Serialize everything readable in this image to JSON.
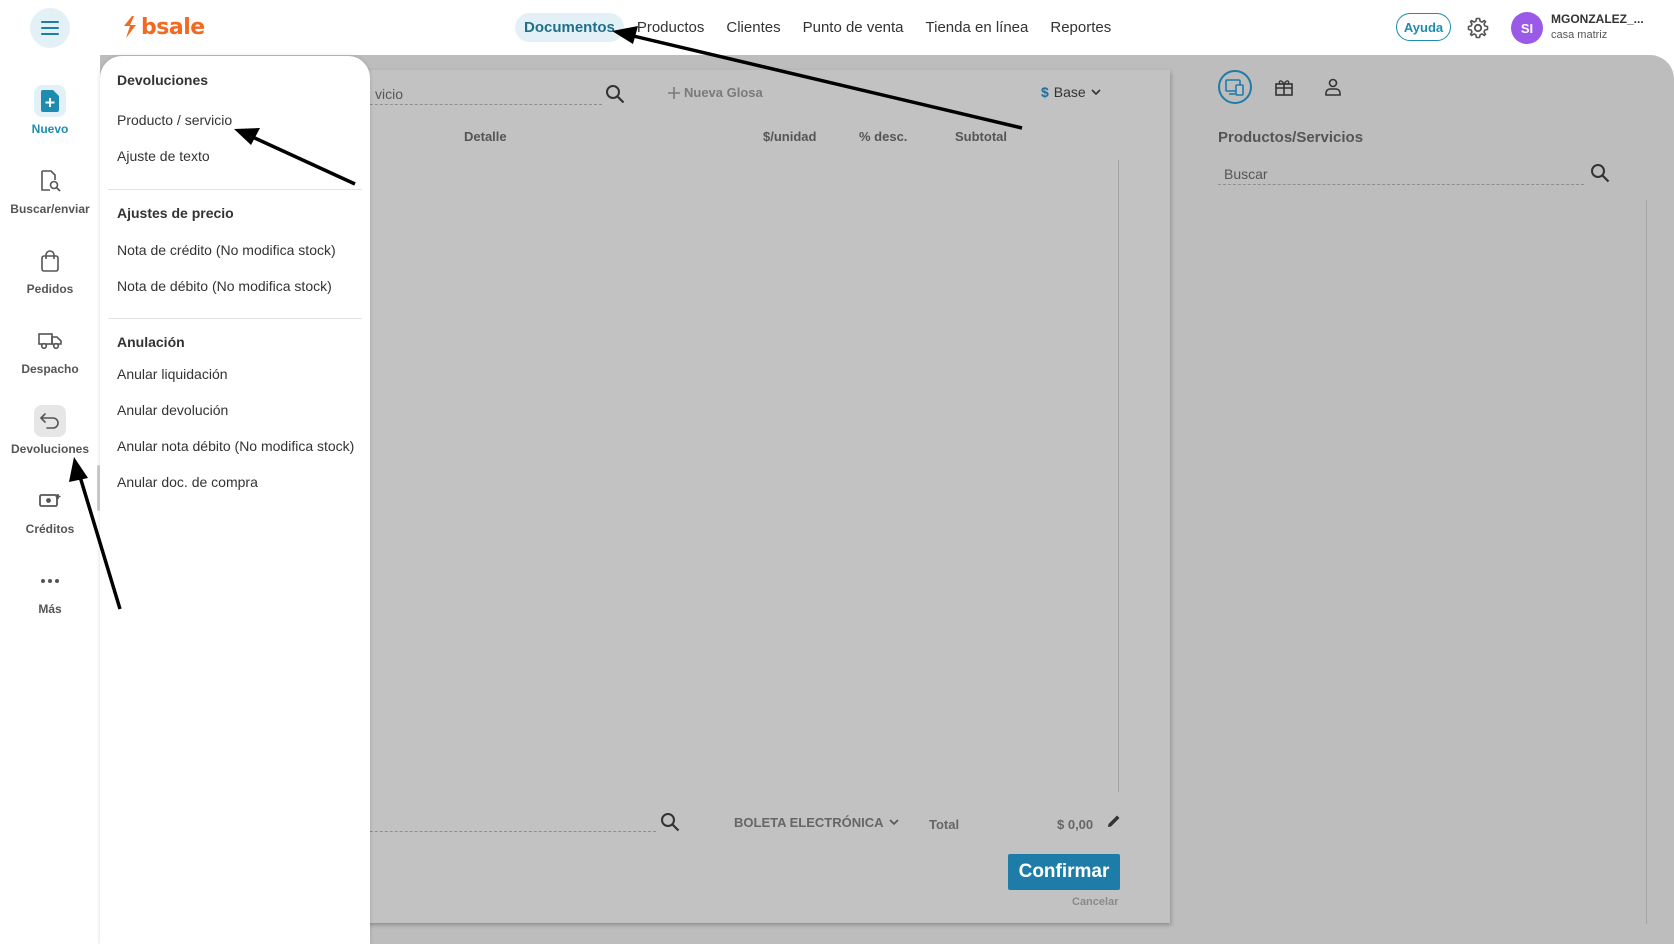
{
  "brand": {
    "logo_text": "bsale",
    "color": "#f26a21"
  },
  "topnav": {
    "items": [
      {
        "label": "Documentos",
        "active": true
      },
      {
        "label": "Productos"
      },
      {
        "label": "Clientes"
      },
      {
        "label": "Punto de venta"
      },
      {
        "label": "Tienda en línea"
      },
      {
        "label": "Reportes"
      }
    ],
    "help_label": "Ayuda"
  },
  "user": {
    "initials": "SI",
    "name": "MGONZALEZ_...",
    "branch": "casa matriz",
    "avatar_color": "#9b59e8"
  },
  "sidebar": {
    "items": [
      {
        "label": "Nuevo",
        "icon": "file-plus-icon",
        "active": true
      },
      {
        "label": "Buscar/enviar",
        "icon": "file-search-icon"
      },
      {
        "label": "Pedidos",
        "icon": "shopping-bag-icon"
      },
      {
        "label": "Despacho",
        "icon": "truck-icon"
      },
      {
        "label": "Devoluciones",
        "icon": "return-arrow-icon",
        "selected": true
      },
      {
        "label": "Créditos",
        "icon": "cash-icon"
      },
      {
        "label": "Más",
        "icon": "more-dots-icon"
      }
    ]
  },
  "menu": {
    "sections": [
      {
        "title": "Devoluciones",
        "items": [
          "Producto / servicio",
          "Ajuste de texto"
        ]
      },
      {
        "title": "Ajustes de precio",
        "items": [
          "Nota de crédito (No modifica stock)",
          "Nota de débito (No modifica stock)"
        ]
      },
      {
        "title": "Anulación",
        "items": [
          "Anular liquidación",
          "Anular devolución",
          "Anular nota débito (No modifica stock)",
          "Anular doc. de compra"
        ]
      }
    ]
  },
  "document": {
    "search_text": "vicio",
    "nueva_glosa": "Nueva Glosa",
    "price_list_symbol": "$",
    "price_list": "Base",
    "columns": {
      "detalle": "Detalle",
      "unit_price": "$/unidad",
      "discount": "% desc.",
      "subtotal": "Subtotal"
    },
    "doc_type": "BOLETA ELECTRÓNICA",
    "total_label": "Total",
    "total_value": "$ 0,00",
    "confirm_label": "Confirmar",
    "cancel_label": "Cancelar"
  },
  "products_panel": {
    "title": "Productos/Servicios",
    "search_placeholder": "Buscar"
  },
  "colors": {
    "accent": "#1e7ca8",
    "overlay": "#bdbdbd"
  }
}
